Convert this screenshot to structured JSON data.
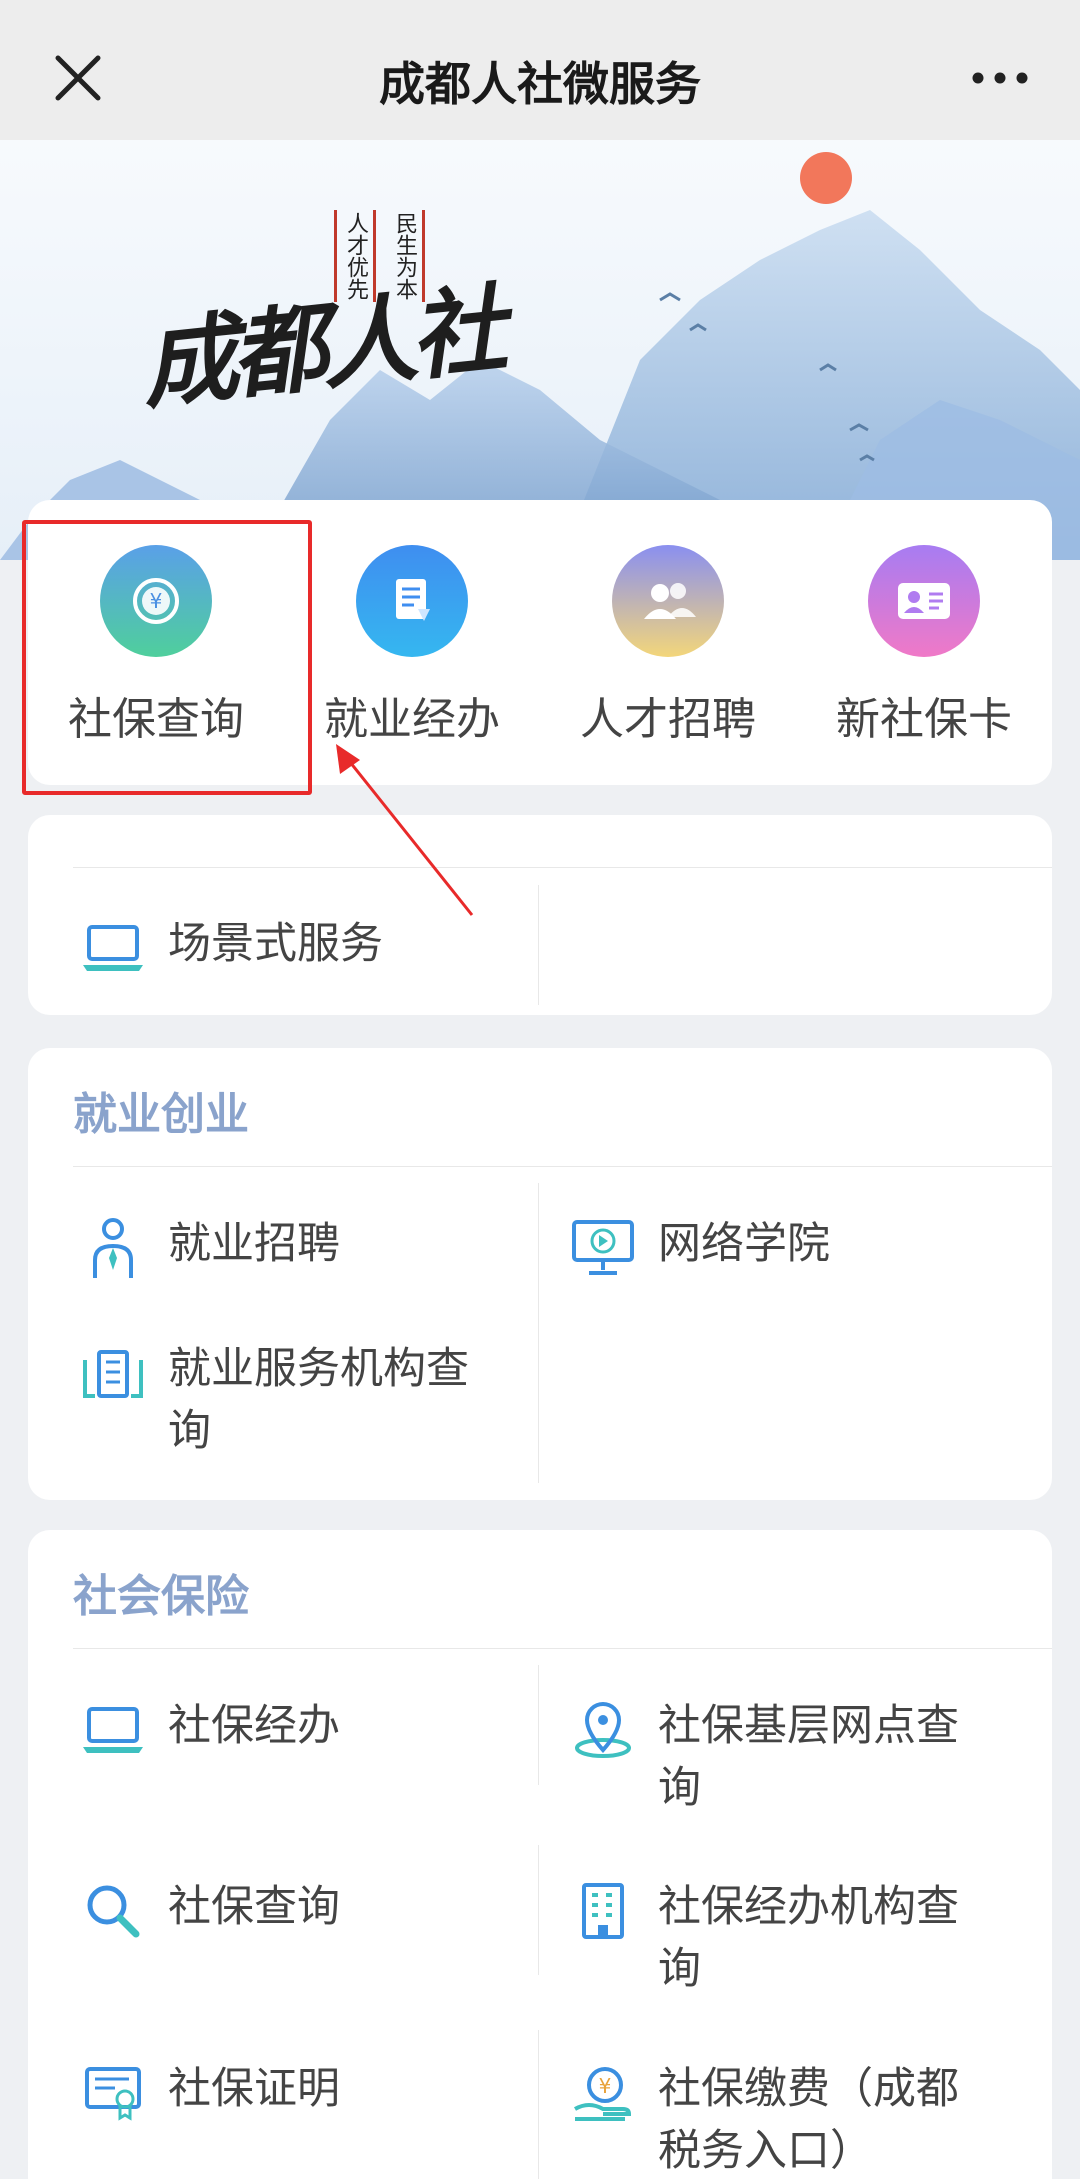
{
  "header": {
    "title": "成都人社微服务"
  },
  "banner": {
    "logo_text": "成都人社",
    "motto_right": "民生为本",
    "motto_left": "人才优先"
  },
  "quick_actions": [
    {
      "label": "社保查询",
      "icon": "yuan-coin-icon",
      "highlighted": true
    },
    {
      "label": "就业经办",
      "icon": "document-icon"
    },
    {
      "label": "人才招聘",
      "icon": "people-icon"
    },
    {
      "label": "新社保卡",
      "icon": "id-card-icon"
    }
  ],
  "scene": {
    "label": "场景式服务",
    "icon": "laptop-icon"
  },
  "employment": {
    "title": "就业创业",
    "items": [
      {
        "label": "就业招聘",
        "icon": "person-tie-icon"
      },
      {
        "label": "网络学院",
        "icon": "monitor-play-icon"
      },
      {
        "label": "就业服务机构查询",
        "icon": "building-icon"
      }
    ]
  },
  "insurance": {
    "title": "社会保险",
    "items": [
      {
        "label": "社保经办",
        "icon": "laptop-icon"
      },
      {
        "label": "社保基层网点查询",
        "icon": "location-pin-icon"
      },
      {
        "label": "社保查询",
        "icon": "magnifier-icon"
      },
      {
        "label": "社保经办机构查询",
        "icon": "office-building-icon"
      },
      {
        "label": "社保证明",
        "icon": "certificate-icon"
      },
      {
        "label": "社保缴费（成都税务入口）",
        "icon": "yuan-hand-icon"
      }
    ]
  },
  "colors": {
    "accent": "#4a90e2",
    "section_title": "#8aa3cc",
    "highlight": "#e82a2a"
  }
}
